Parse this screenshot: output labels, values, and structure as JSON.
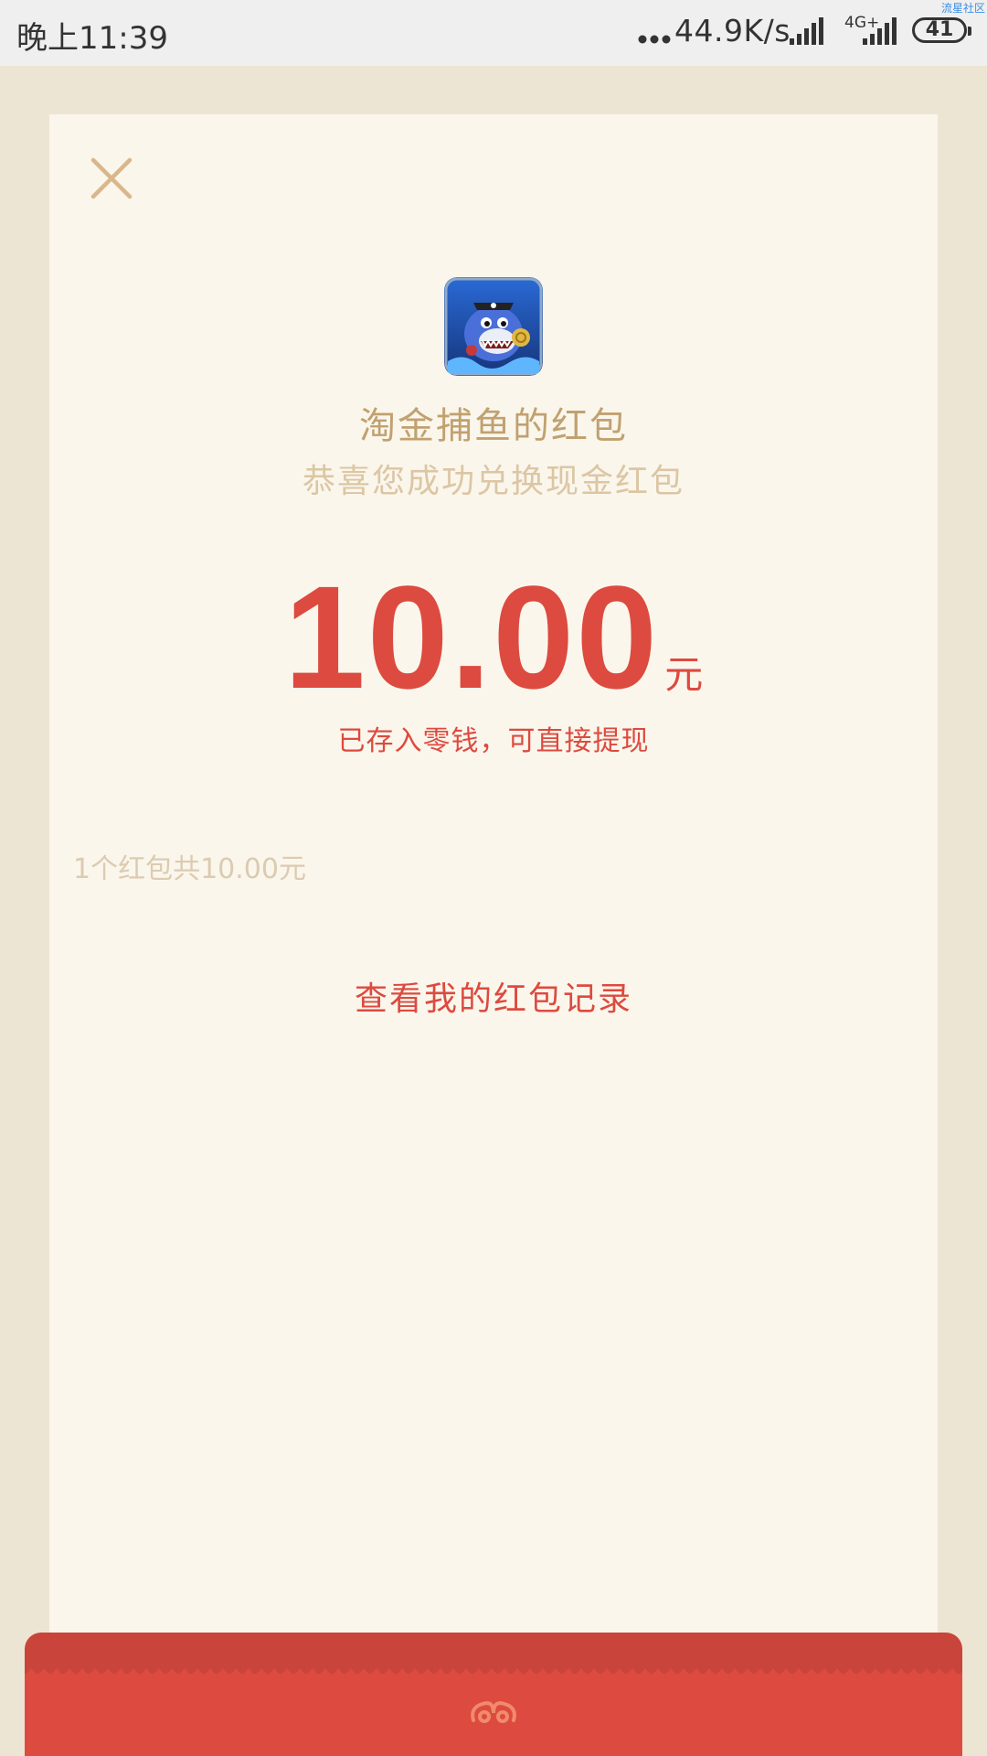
{
  "status_bar": {
    "time": "晚上11:39",
    "speed": "44.9K/s",
    "network": "4G+",
    "battery": "41",
    "watermark": "流星社区"
  },
  "card": {
    "close_icon": "close-icon",
    "app_icon": "shark-game-icon",
    "title": "淘金捕鱼的红包",
    "subtitle": "恭喜您成功兑换现金红包",
    "amount": "10.00",
    "unit": "元",
    "saved_note": "已存入零钱，可直接提现",
    "summary": "1个红包共10.00元",
    "records_link": "查看我的红包记录"
  },
  "colors": {
    "page_bg": "#ede5d3",
    "card_bg": "#faf6ec",
    "accent_red": "#dd4a3f",
    "gold": "#c1a16f"
  }
}
